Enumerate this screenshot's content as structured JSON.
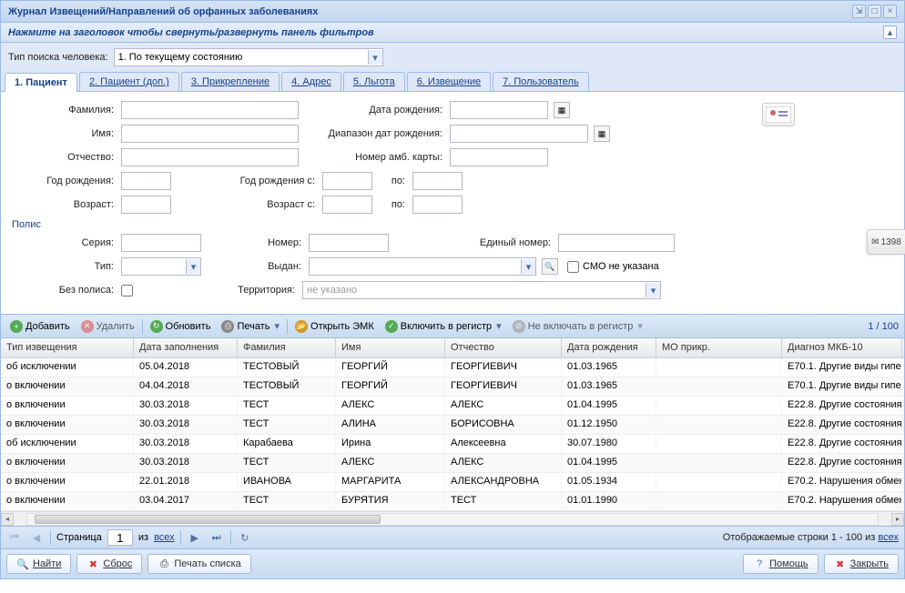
{
  "window": {
    "title": "Журнал Извещений/Направлений об орфанных заболеваниях"
  },
  "filter_header": "Нажмите на заголовок чтобы свернуть/развернуть панель фильтров",
  "search_type": {
    "label": "Тип поиска человека:",
    "value": "1. По текущему состоянию"
  },
  "tabs": [
    {
      "label": "1. Пациент"
    },
    {
      "label": "2. Пациент (доп.)"
    },
    {
      "label": "3. Прикрепление"
    },
    {
      "label": "4. Адрес"
    },
    {
      "label": "5. Льгота"
    },
    {
      "label": "6. Извещение"
    },
    {
      "label": "7. Пользователь"
    }
  ],
  "form": {
    "surname": "Фамилия:",
    "name": "Имя:",
    "patronymic": "Отчество:",
    "birth_year": "Год рождения:",
    "age": "Возраст:",
    "birth_date": "Дата рождения:",
    "birth_range": "Диапазон дат рождения:",
    "card_num": "Номер амб. карты:",
    "birth_year_from": "Год рождения с:",
    "to": "по:",
    "age_from": "Возраст с:",
    "polis_legend": "Полис",
    "series": "Серия:",
    "number": "Номер:",
    "unified": "Единый номер:",
    "type": "Тип:",
    "issued": "Выдан:",
    "smo_not": "СМО не указана",
    "no_polis": "Без полиса:",
    "territory": "Территория:",
    "territory_ph": "не указано"
  },
  "toolbar": {
    "add": "Добавить",
    "delete": "Удалить",
    "refresh": "Обновить",
    "print": "Печать",
    "open_emk": "Открыть ЭМК",
    "include": "Включить в регистр",
    "exclude": "Не включать в регистр",
    "counter": "1 / 100"
  },
  "grid": {
    "columns": [
      "Тип извещения",
      "Дата заполнения",
      "Фамилия",
      "Имя",
      "Отчество",
      "Дата рождения",
      "МО прикр.",
      "Диагноз МКБ-10"
    ],
    "rows": [
      [
        "об исключении",
        "05.04.2018",
        "ТЕСТОВЫЙ",
        "ГЕОРГИЙ",
        "ГЕОРГИЕВИЧ",
        "01.03.1965",
        "",
        "E70.1. Другие виды гипе"
      ],
      [
        "о включении",
        "04.04.2018",
        "ТЕСТОВЫЙ",
        "ГЕОРГИЙ",
        "ГЕОРГИЕВИЧ",
        "01.03.1965",
        "",
        "E70.1. Другие виды гипе"
      ],
      [
        "о включении",
        "30.03.2018",
        "ТЕСТ",
        "АЛЕКС",
        "АЛЕКС",
        "01.04.1995",
        "",
        "E22.8. Другие состояния"
      ],
      [
        "о включении",
        "30.03.2018",
        "ТЕСТ",
        "АЛИНА",
        "БОРИСОВНА",
        "01.12.1950",
        "",
        "E22.8. Другие состояния"
      ],
      [
        "об исключении",
        "30.03.2018",
        "Карабаева",
        "Ирина",
        "Алексеевна",
        "30.07.1980",
        "",
        "E22.8. Другие состояния"
      ],
      [
        "о включении",
        "30.03.2018",
        "ТЕСТ",
        "АЛЕКС",
        "АЛЕКС",
        "01.04.1995",
        "",
        "E22.8. Другие состояния"
      ],
      [
        "о включении",
        "22.01.2018",
        "ИВАНОВА",
        "МАРГАРИТА",
        "АЛЕКСАНДРОВНА",
        "01.05.1934",
        "",
        "E70.2. Нарушения обмен"
      ],
      [
        "о включении",
        "03.04.2017",
        "ТЕСТ",
        "БУРЯТИЯ",
        "ТЕСТ",
        "01.01.1990",
        "",
        "E70.2. Нарушения обмен"
      ]
    ]
  },
  "pager": {
    "page_label": "Страница",
    "page": "1",
    "of": "из",
    "total": "всех",
    "display_prefix": "Отображаемые строки 1 - 100 из ",
    "display_total": "всех"
  },
  "bottom": {
    "find": "Найти",
    "reset": "Сброс",
    "print_list": "Печать списка",
    "help": "Помощь",
    "close": "Закрыть"
  },
  "notif": {
    "count": "1398"
  }
}
